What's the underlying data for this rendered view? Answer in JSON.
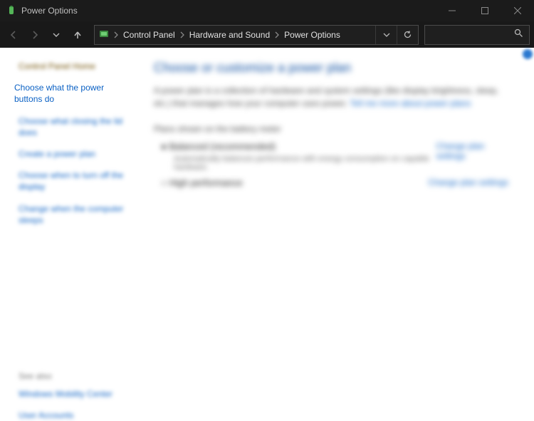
{
  "window": {
    "title": "Power Options"
  },
  "breadcrumb": {
    "seg1": "Control Panel",
    "seg2": "Hardware and Sound",
    "seg3": "Power Options"
  },
  "sidebar": {
    "home": "Control Panel Home",
    "active": "Choose what the power buttons do",
    "i2": "Choose what closing the lid does",
    "i3": "Create a power plan",
    "i4": "Choose when to turn off the display",
    "i5": "Change when the computer sleeps",
    "seealso_hd": "See also",
    "sa1": "Windows Mobility Center",
    "sa2": "User Accounts"
  },
  "main": {
    "heading": "Choose or customize a power plan",
    "desc_a": "A power plan is a collection of hardware and system settings (like display brightness, sleep, etc.) that manages how your computer uses power. ",
    "desc_link": "Tell me more about power plans",
    "section_label": "Plans shown on the battery meter",
    "plan1": {
      "name": "● Balanced (recommended)",
      "sub": "Automatically balances performance with energy consumption on capable hardware.",
      "link": "Change plan settings"
    },
    "plan2": {
      "name": "○ High performance",
      "link": "Change plan settings"
    }
  }
}
